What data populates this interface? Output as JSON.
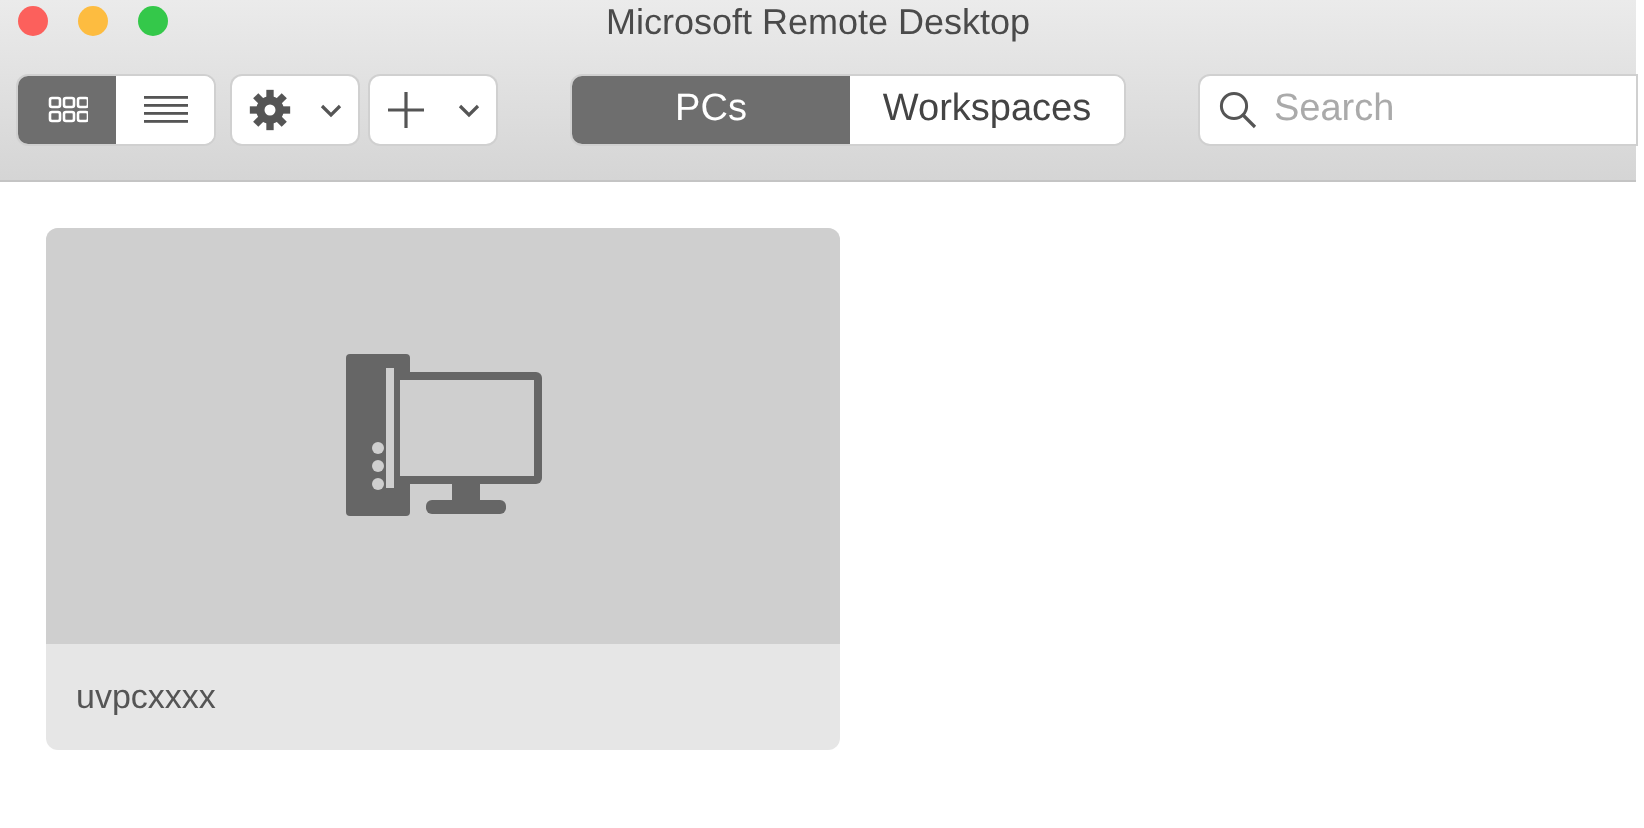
{
  "window": {
    "title": "Microsoft Remote Desktop"
  },
  "view_modes": [
    {
      "kind": "grid",
      "selected": true
    },
    {
      "kind": "list",
      "selected": false
    }
  ],
  "menus": [
    {
      "kind": "settings"
    },
    {
      "kind": "add"
    }
  ],
  "tabs": [
    {
      "label": "PCs",
      "selected": true
    },
    {
      "label": "Workspaces",
      "selected": false
    }
  ],
  "search": {
    "placeholder": "Search"
  },
  "pcs": [
    {
      "name": "uvpcxxxx"
    }
  ]
}
